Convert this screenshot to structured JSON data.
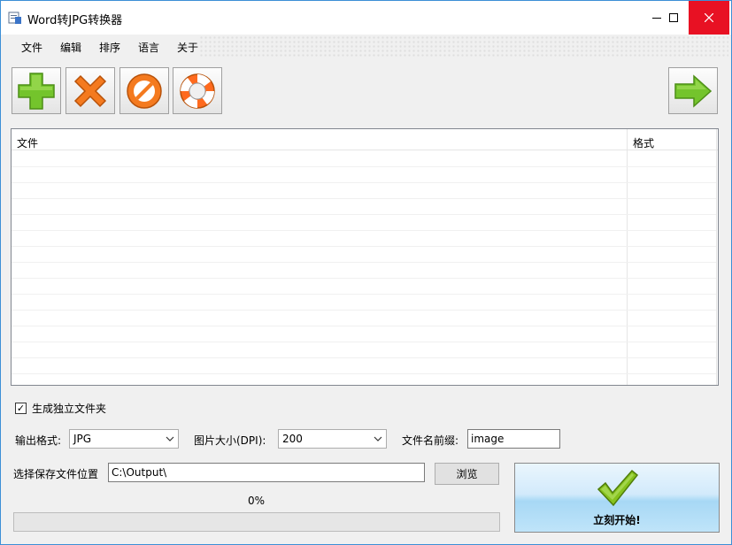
{
  "window": {
    "title": "Word转JPG转换器"
  },
  "menu": [
    "文件",
    "编辑",
    "排序",
    "语言",
    "关于"
  ],
  "toolbar": {
    "buttons": [
      {
        "name": "add-button",
        "icon": "plus-icon",
        "color": "#6cc12a"
      },
      {
        "name": "remove-button",
        "icon": "x-icon",
        "color": "#f07818"
      },
      {
        "name": "clear-button",
        "icon": "no-entry-icon",
        "color": "#f07818"
      },
      {
        "name": "help-button",
        "icon": "lifebuoy-icon",
        "color": "#ff6a1e"
      }
    ],
    "next_icon": "arrow-right-icon"
  },
  "list": {
    "columns": [
      "文件",
      "格式"
    ],
    "rows": []
  },
  "options": {
    "separate_folder_label": "生成独立文件夹",
    "separate_folder_checked": true,
    "output_format_label": "输出格式:",
    "output_format_value": "JPG",
    "dpi_label": "图片大小(DPI):",
    "dpi_value": "200",
    "prefix_label": "文件名前缀:",
    "prefix_value": "image",
    "save_location_label": "选择保存文件位置",
    "save_location_value": "C:\\Output\\",
    "browse_label": "浏览"
  },
  "progress": {
    "percent_text": "0%",
    "value": 0
  },
  "start_button": {
    "label": "立刻开始!"
  },
  "colors": {
    "accent": "#3c8fd6",
    "close": "#e81123",
    "check": "#7ab317"
  }
}
